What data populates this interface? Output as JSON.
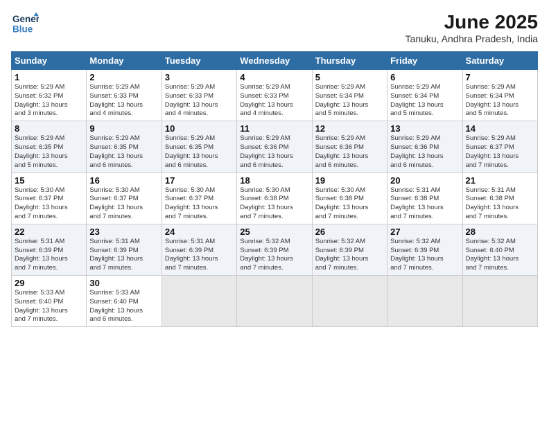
{
  "logo": {
    "line1": "General",
    "line2": "Blue"
  },
  "title": "June 2025",
  "subtitle": "Tanuku, Andhra Pradesh, India",
  "weekdays": [
    "Sunday",
    "Monday",
    "Tuesday",
    "Wednesday",
    "Thursday",
    "Friday",
    "Saturday"
  ],
  "weeks": [
    [
      {
        "day": "1",
        "info": "Sunrise: 5:29 AM\nSunset: 6:32 PM\nDaylight: 13 hours\nand 3 minutes."
      },
      {
        "day": "2",
        "info": "Sunrise: 5:29 AM\nSunset: 6:33 PM\nDaylight: 13 hours\nand 4 minutes."
      },
      {
        "day": "3",
        "info": "Sunrise: 5:29 AM\nSunset: 6:33 PM\nDaylight: 13 hours\nand 4 minutes."
      },
      {
        "day": "4",
        "info": "Sunrise: 5:29 AM\nSunset: 6:33 PM\nDaylight: 13 hours\nand 4 minutes."
      },
      {
        "day": "5",
        "info": "Sunrise: 5:29 AM\nSunset: 6:34 PM\nDaylight: 13 hours\nand 5 minutes."
      },
      {
        "day": "6",
        "info": "Sunrise: 5:29 AM\nSunset: 6:34 PM\nDaylight: 13 hours\nand 5 minutes."
      },
      {
        "day": "7",
        "info": "Sunrise: 5:29 AM\nSunset: 6:34 PM\nDaylight: 13 hours\nand 5 minutes."
      }
    ],
    [
      {
        "day": "8",
        "info": "Sunrise: 5:29 AM\nSunset: 6:35 PM\nDaylight: 13 hours\nand 5 minutes."
      },
      {
        "day": "9",
        "info": "Sunrise: 5:29 AM\nSunset: 6:35 PM\nDaylight: 13 hours\nand 6 minutes."
      },
      {
        "day": "10",
        "info": "Sunrise: 5:29 AM\nSunset: 6:35 PM\nDaylight: 13 hours\nand 6 minutes."
      },
      {
        "day": "11",
        "info": "Sunrise: 5:29 AM\nSunset: 6:36 PM\nDaylight: 13 hours\nand 6 minutes."
      },
      {
        "day": "12",
        "info": "Sunrise: 5:29 AM\nSunset: 6:36 PM\nDaylight: 13 hours\nand 6 minutes."
      },
      {
        "day": "13",
        "info": "Sunrise: 5:29 AM\nSunset: 6:36 PM\nDaylight: 13 hours\nand 6 minutes."
      },
      {
        "day": "14",
        "info": "Sunrise: 5:29 AM\nSunset: 6:37 PM\nDaylight: 13 hours\nand 7 minutes."
      }
    ],
    [
      {
        "day": "15",
        "info": "Sunrise: 5:30 AM\nSunset: 6:37 PM\nDaylight: 13 hours\nand 7 minutes."
      },
      {
        "day": "16",
        "info": "Sunrise: 5:30 AM\nSunset: 6:37 PM\nDaylight: 13 hours\nand 7 minutes."
      },
      {
        "day": "17",
        "info": "Sunrise: 5:30 AM\nSunset: 6:37 PM\nDaylight: 13 hours\nand 7 minutes."
      },
      {
        "day": "18",
        "info": "Sunrise: 5:30 AM\nSunset: 6:38 PM\nDaylight: 13 hours\nand 7 minutes."
      },
      {
        "day": "19",
        "info": "Sunrise: 5:30 AM\nSunset: 6:38 PM\nDaylight: 13 hours\nand 7 minutes."
      },
      {
        "day": "20",
        "info": "Sunrise: 5:31 AM\nSunset: 6:38 PM\nDaylight: 13 hours\nand 7 minutes."
      },
      {
        "day": "21",
        "info": "Sunrise: 5:31 AM\nSunset: 6:38 PM\nDaylight: 13 hours\nand 7 minutes."
      }
    ],
    [
      {
        "day": "22",
        "info": "Sunrise: 5:31 AM\nSunset: 6:39 PM\nDaylight: 13 hours\nand 7 minutes."
      },
      {
        "day": "23",
        "info": "Sunrise: 5:31 AM\nSunset: 6:39 PM\nDaylight: 13 hours\nand 7 minutes."
      },
      {
        "day": "24",
        "info": "Sunrise: 5:31 AM\nSunset: 6:39 PM\nDaylight: 13 hours\nand 7 minutes."
      },
      {
        "day": "25",
        "info": "Sunrise: 5:32 AM\nSunset: 6:39 PM\nDaylight: 13 hours\nand 7 minutes."
      },
      {
        "day": "26",
        "info": "Sunrise: 5:32 AM\nSunset: 6:39 PM\nDaylight: 13 hours\nand 7 minutes."
      },
      {
        "day": "27",
        "info": "Sunrise: 5:32 AM\nSunset: 6:39 PM\nDaylight: 13 hours\nand 7 minutes."
      },
      {
        "day": "28",
        "info": "Sunrise: 5:32 AM\nSunset: 6:40 PM\nDaylight: 13 hours\nand 7 minutes."
      }
    ],
    [
      {
        "day": "29",
        "info": "Sunrise: 5:33 AM\nSunset: 6:40 PM\nDaylight: 13 hours\nand 7 minutes."
      },
      {
        "day": "30",
        "info": "Sunrise: 5:33 AM\nSunset: 6:40 PM\nDaylight: 13 hours\nand 6 minutes."
      },
      {
        "day": "",
        "info": ""
      },
      {
        "day": "",
        "info": ""
      },
      {
        "day": "",
        "info": ""
      },
      {
        "day": "",
        "info": ""
      },
      {
        "day": "",
        "info": ""
      }
    ]
  ]
}
